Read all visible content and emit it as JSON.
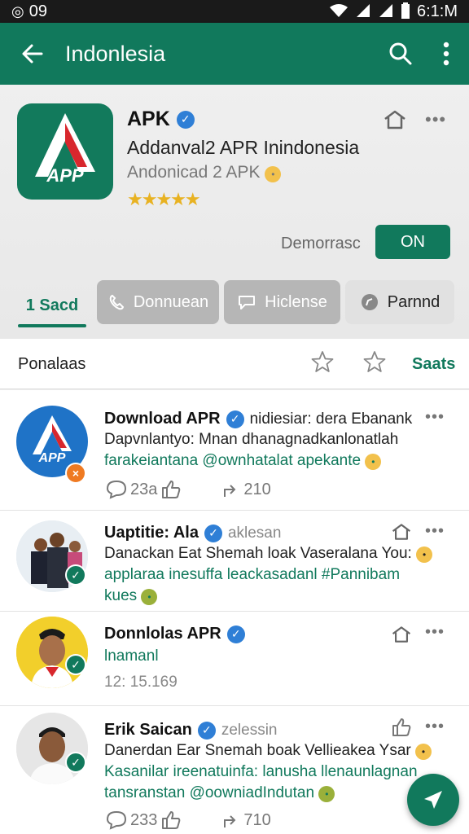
{
  "status_bar": {
    "left": "09",
    "time": "6:1:M"
  },
  "app_bar": {
    "title": "Indonlesia"
  },
  "app": {
    "name": "APK",
    "subtitle": "Addanval2 APR Inindonesia",
    "subtitle2": "Andonicad 2 APK",
    "icon_text": "APP",
    "rating_stars": "★★★★★",
    "demo_label": "Demorrasc",
    "on_button": "ON"
  },
  "tabs": [
    {
      "label": "1 Sacd"
    },
    {
      "label": "Donnuean"
    },
    {
      "label": "Hiclense"
    },
    {
      "label": "Parnnd"
    }
  ],
  "filter": {
    "label": "Ponalaas",
    "right_label": "Saats"
  },
  "posts": [
    {
      "author": "Download APR",
      "handle": "nidiesiar: dera Ebanank",
      "line1": "Dapvnlantyo: Mnan dhanagnadkanlonatlah",
      "line2": "farakeiantana @ownhatalat apekante",
      "comments": "23a",
      "shares": "210",
      "avatar_text": "APP"
    },
    {
      "author": "Uaptitie: Ala",
      "handle": "aklesan",
      "line1": "Danackan Eat Shemah loak Vaseralana You:",
      "line2": "applaraa inesuffa leackasadanl #Pannibam",
      "line3": "kues"
    },
    {
      "author": "Donnlolas APR",
      "line1": "lnamanl",
      "line2": "12: 15.169"
    },
    {
      "author": "Erik Saican",
      "handle": "zelessin",
      "line1": "Danerdan Ear Snemah boak Vellieakea Ysar",
      "line2": "Kasanilar ireenatuinfa: lanusha llenaunlagnan",
      "line3": "tansranstan @oowniadIndutan",
      "comments": "233",
      "shares": "710"
    }
  ],
  "colors": {
    "brand": "#11795c",
    "verified": "#2f7fd6",
    "star": "#e8b222"
  }
}
